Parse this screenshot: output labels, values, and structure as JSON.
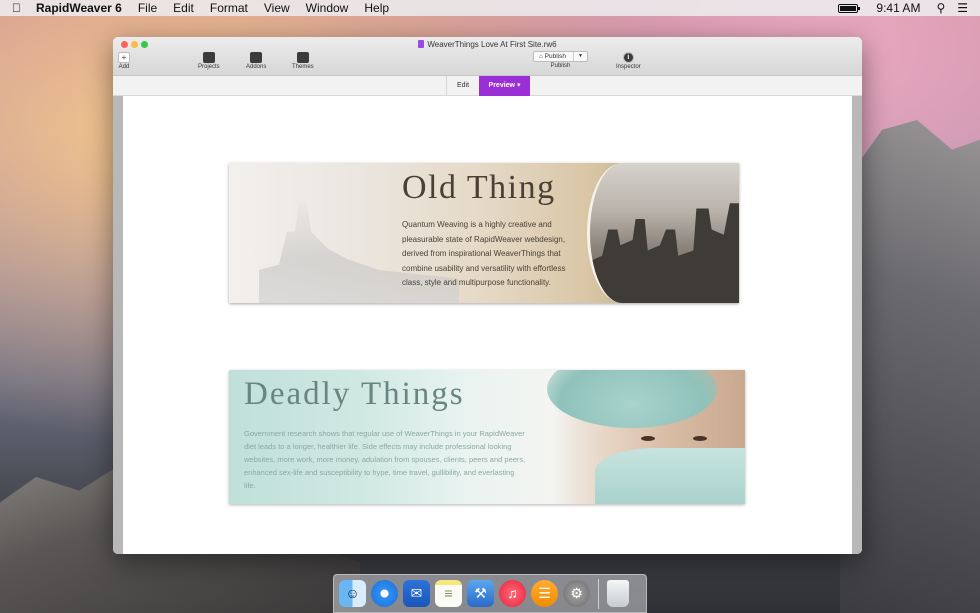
{
  "menubar": {
    "apple_icon": "apple-icon",
    "app_name": "RapidWeaver 6",
    "menus": [
      "File",
      "Edit",
      "Format",
      "View",
      "Window",
      "Help"
    ],
    "clock": "9:41 AM"
  },
  "window": {
    "title": "WeaverThings Love At First Site.rw6",
    "toolbar": {
      "add_label": "Add",
      "projects_label": "Projects",
      "addons_label": "Addons",
      "themes_label": "Themes",
      "publish_button": "Publish",
      "publish_label": "Publish",
      "inspector_label": "Inspector"
    },
    "tabs": {
      "edit": "Edit",
      "preview": "Preview"
    }
  },
  "content": {
    "banner1": {
      "title": "Old Thing",
      "text": "Quantum Weaving is a highly creative and pleasurable state of RapidWeaver webdesign, derived from inspirational WeaverThings that combine usability and versatility with effortless class, style and multipurpose functionality."
    },
    "banner2": {
      "title": "Deadly Things",
      "text": "Government research shows that regular use of WeaverThings in your RapidWeaver diet leads to a longer, healthier life. Side effects may include professional looking websites, more work, more money, adulation from spouses, clients, peers and peers, enhanced sex-life and susceptibility to hype, time travel, gullibility, and everlasting life."
    }
  },
  "dock": {
    "apps": [
      "finder-icon",
      "safari-icon",
      "mail-icon",
      "notes-icon",
      "xcode-icon",
      "itunes-icon",
      "ibooks-icon",
      "system-preferences-icon",
      "trash-icon"
    ]
  }
}
